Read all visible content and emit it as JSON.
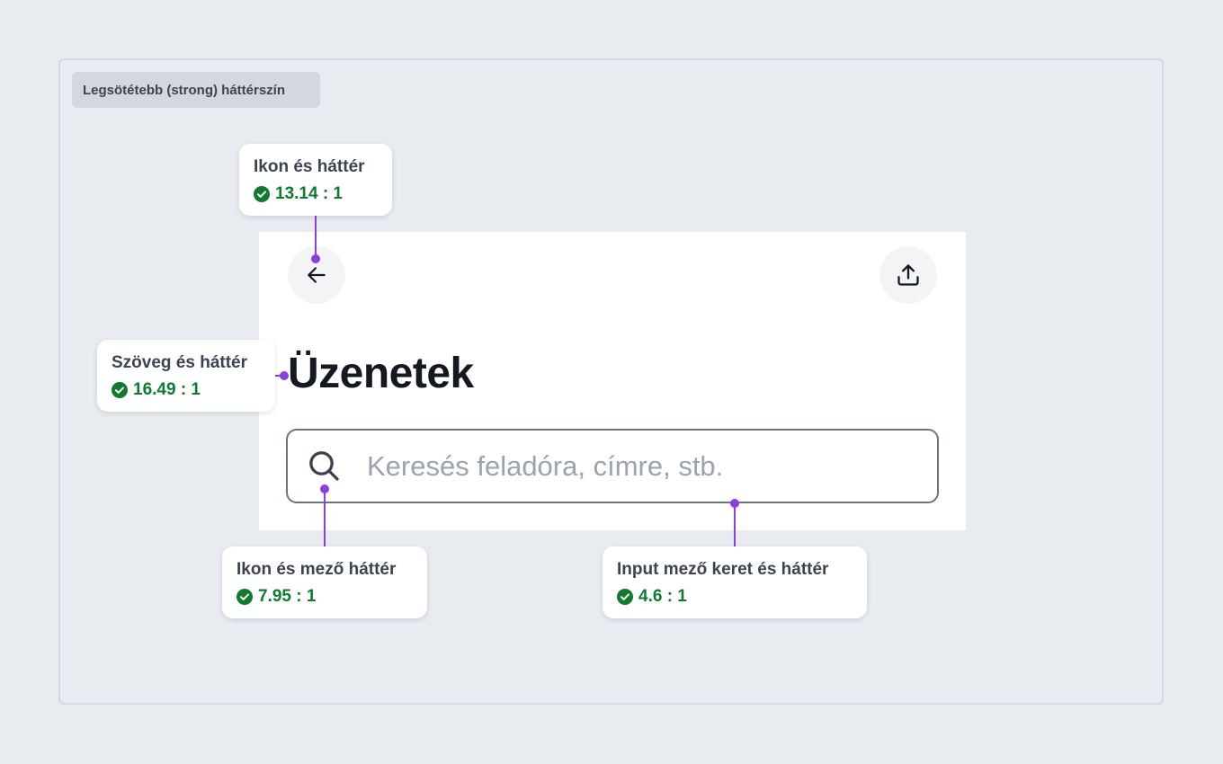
{
  "frame": {
    "label": "Legsötétebb (strong) háttérszín"
  },
  "mockup": {
    "back_icon": "arrow-left-icon",
    "share_icon": "upload-icon",
    "title": "Üzenetek",
    "search": {
      "icon": "search-icon",
      "placeholder": "Keresés feladóra, címre, stb.",
      "value": ""
    }
  },
  "annotations": [
    {
      "title": "Ikon és háttér",
      "ratio": "13.14 : 1"
    },
    {
      "title": "Szöveg és háttér",
      "ratio": "16.49 : 1"
    },
    {
      "title": "Ikon és mező háttér",
      "ratio": "7.95 : 1"
    },
    {
      "title": "Input mező keret és háttér",
      "ratio": "4.6 : 1"
    }
  ],
  "colors": {
    "page_background": "#e8ebf0",
    "accent_connector": "#8b3fe0",
    "pass_green": "#0f7b2e",
    "text_dark": "#141820",
    "placeholder": "#9ca3af",
    "input_border": "#6b7280"
  }
}
